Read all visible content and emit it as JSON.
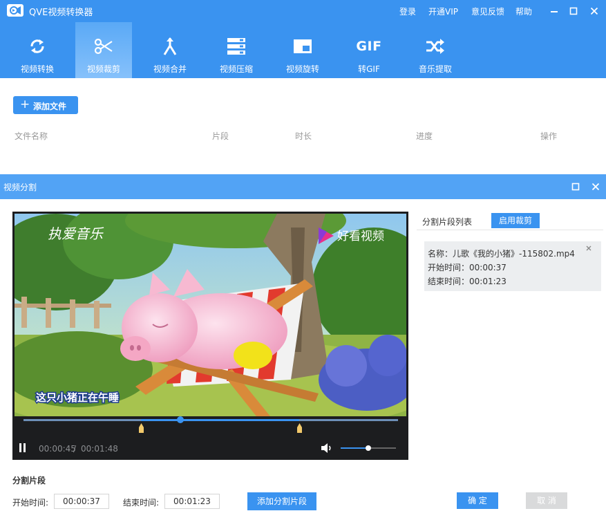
{
  "app": {
    "title": "QVE视频转换器",
    "links": {
      "login": "登录",
      "vip": "开通VIP",
      "feedback": "意见反馈",
      "help": "帮助"
    }
  },
  "nav": {
    "items": [
      {
        "label": "视频转换",
        "icon": "refresh-icon"
      },
      {
        "label": "视频裁剪",
        "icon": "scissors-icon",
        "active": true
      },
      {
        "label": "视频合并",
        "icon": "merge-icon"
      },
      {
        "label": "视频压缩",
        "icon": "compress-icon"
      },
      {
        "label": "视频旋转",
        "icon": "rotate-icon"
      },
      {
        "label": "转GIF",
        "icon": "gif-icon",
        "icon_text": "GIF"
      },
      {
        "label": "音乐提取",
        "icon": "shuffle-icon"
      }
    ]
  },
  "files": {
    "add_label": "添加文件",
    "columns": [
      "文件名称",
      "片段",
      "时长",
      "进度",
      "操作"
    ]
  },
  "dialog": {
    "title": "视频分割",
    "video": {
      "watermark": "好看视频",
      "caption_top": "执爱音乐",
      "subtitle": "这只小猪正在午睡",
      "current_time": "00:00:45",
      "separator": "/",
      "total_time": "00:01:48",
      "progress": 0.417,
      "segment_start_fraction": 0.343,
      "segment_end_fraction": 0.769,
      "volume": 0.5
    },
    "segment_list": {
      "title": "分割片段列表",
      "enable_button": "启用裁剪",
      "items": [
        {
          "name": "名称：儿歌《我的小猪》-115802.mp4",
          "start": "开始时间：00:00:37",
          "end": "结束时间：00:01:23"
        }
      ]
    },
    "form": {
      "section_label": "分割片段",
      "start_label": "开始时间:",
      "start_value": "00:00:37",
      "end_label": "结束时间:",
      "end_value": "00:01:23",
      "add_button": "添加分割片段",
      "ok_button": "确 定",
      "cancel_button": "取 消"
    }
  },
  "colors": {
    "primary": "#3a93f0",
    "dialog_header": "#52a3f5",
    "disabled": "#d9dadb"
  }
}
